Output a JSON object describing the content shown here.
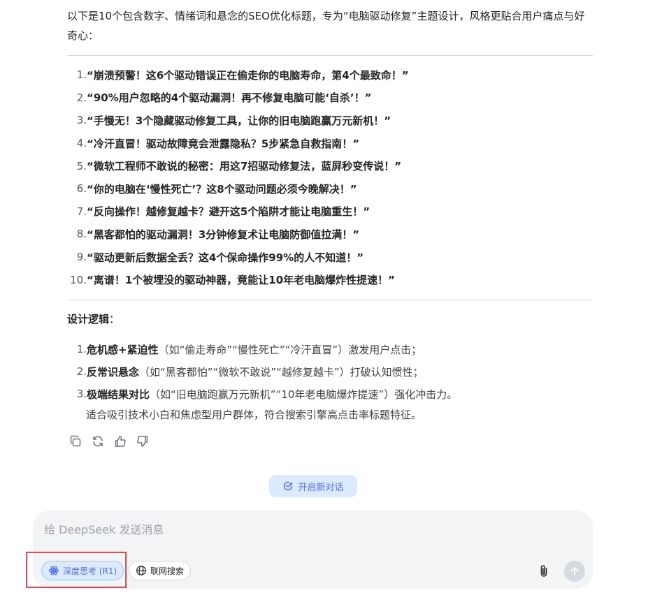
{
  "intro_text": "以下是10个包含数字、情绪词和悬念的SEO优化标题，专为“电脑驱动修复”主题设计，风格更贴合用户痛点与好奇心：",
  "titles": [
    {
      "num": "1.",
      "text": "“崩溃预警！这6个驱动错误正在偷走你的电脑寿命，第4个最致命！”"
    },
    {
      "num": "2.",
      "text": "“90%用户忽略的4个驱动漏洞！再不修复电脑可能‘自杀’！”"
    },
    {
      "num": "3.",
      "text": "“手慢无！3个隐藏驱动修复工具，让你的旧电脑跑赢万元新机！”"
    },
    {
      "num": "4.",
      "text": "“冷汗直冒！驱动故障竟会泄露隐私？5步紧急自救指南！”"
    },
    {
      "num": "5.",
      "text": "“微软工程师不敢说的秘密：用这7招驱动修复法，蓝屏秒变传说！”"
    },
    {
      "num": "6.",
      "text": "“你的电脑在‘慢性死亡’？这8个驱动问题必须今晚解决！”"
    },
    {
      "num": "7.",
      "text": "“反向操作！越修复越卡？避开这5个陷阱才能让电脑重生！”"
    },
    {
      "num": "8.",
      "text": "“黑客都怕的驱动漏洞！3分钟修复术让电脑防御值拉满！”"
    },
    {
      "num": "9.",
      "text": "“驱动更新后数据全丢？这4个保命操作99%的人不知道！”"
    },
    {
      "num": "10.",
      "text": "“离谱！1个被埋没的驱动神器，竟能让10年老电脑爆炸性提速！”"
    }
  ],
  "logic": {
    "heading": "设计逻辑",
    "colon": "：",
    "items": [
      {
        "num": "1.",
        "bold": "危机感+紧迫性",
        "rest": "（如“偷走寿命”“慢性死亡”“冷汗直冒”）激发用户点击；"
      },
      {
        "num": "2.",
        "bold": "反常识悬念",
        "rest": "（如“黑客都怕”“微软不敢说”“越修复越卡”）打破认知惯性；"
      },
      {
        "num": "3.",
        "bold": "极端结果对比",
        "rest": "（如“旧电脑跑赢万元新机”“10年老电脑爆炸提速”）强化冲击力。"
      }
    ],
    "summary": "适合吸引技术小白和焦虑型用户群体，符合搜索引擎高点击率标题特征。"
  },
  "actions": {
    "icons": [
      "copy-icon",
      "regenerate-icon",
      "thumbs-up-icon",
      "thumbs-down-icon"
    ]
  },
  "new_chat": {
    "label": "开启新对话",
    "icon": "new-chat-icon"
  },
  "composer": {
    "placeholder": "给 DeepSeek 发送消息",
    "deep_think_label": "深度思考 (R1)",
    "web_search_label": "联网搜索"
  },
  "colors": {
    "accent": "#4d6bfe",
    "chip_bg": "#dbeafe",
    "highlight_border": "#e5484d",
    "composer_bg": "#f3f4f6"
  }
}
